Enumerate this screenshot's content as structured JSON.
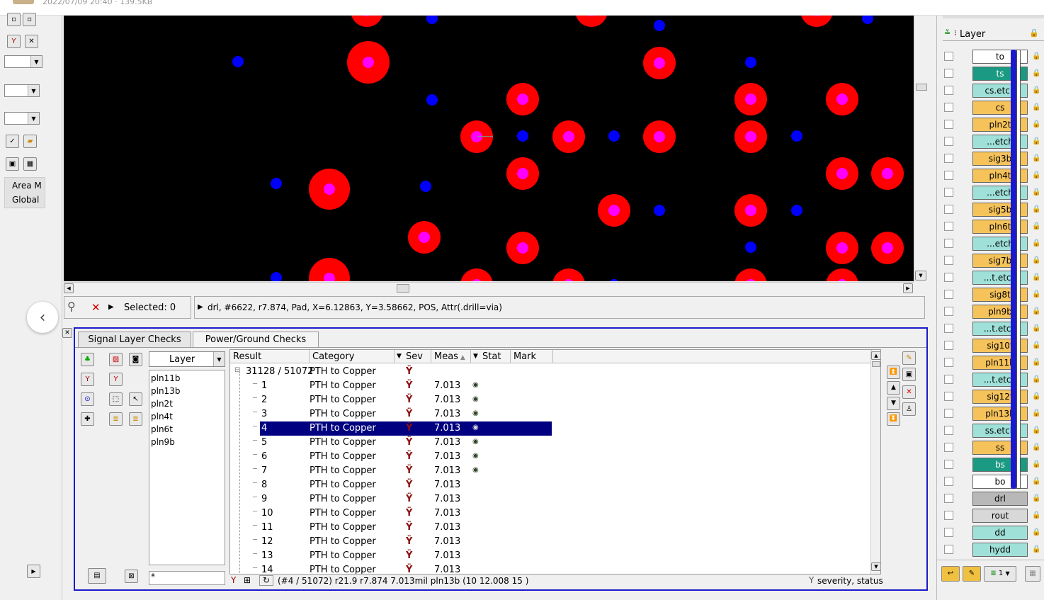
{
  "topbar": {
    "date_text": "2022/07/09 20:40 · 139.5KB"
  },
  "left_panel": {
    "area_label": "Area M",
    "global_label": "Global"
  },
  "status": {
    "selected_text": "Selected: 0",
    "info_text": "drl, #6622, r7.874, Pad, X=6.12863, Y=3.58662, POS, Attr(.drill=via)"
  },
  "checks": {
    "tabs": [
      {
        "label": "Signal Layer Checks",
        "active": false
      },
      {
        "label": "Power/Ground Checks",
        "active": true
      }
    ],
    "layer_combo": "Layer",
    "layers": [
      "pln11b",
      "pln13b",
      "pln2t",
      "pln4t",
      "pln6t",
      "pln9b"
    ],
    "filter_text": "*",
    "columns": [
      "Result",
      "Category",
      "Sev",
      "Meas",
      "Stat",
      "Mark"
    ],
    "group": {
      "result": "31128 / 51072",
      "category": "PTH to Copper"
    },
    "rows": [
      {
        "result": "1",
        "category": "PTH to Copper",
        "meas": "7.013",
        "stat": true
      },
      {
        "result": "2",
        "category": "PTH to Copper",
        "meas": "7.013",
        "stat": true
      },
      {
        "result": "3",
        "category": "PTH to Copper",
        "meas": "7.013",
        "stat": true
      },
      {
        "result": "4",
        "category": "PTH to Copper",
        "meas": "7.013",
        "stat": true,
        "selected": true
      },
      {
        "result": "5",
        "category": "PTH to Copper",
        "meas": "7.013",
        "stat": true
      },
      {
        "result": "6",
        "category": "PTH to Copper",
        "meas": "7.013",
        "stat": true
      },
      {
        "result": "7",
        "category": "PTH to Copper",
        "meas": "7.013",
        "stat": true
      },
      {
        "result": "8",
        "category": "PTH to Copper",
        "meas": "7.013",
        "stat": false
      },
      {
        "result": "9",
        "category": "PTH to Copper",
        "meas": "7.013",
        "stat": false
      },
      {
        "result": "10",
        "category": "PTH to Copper",
        "meas": "7.013",
        "stat": false
      },
      {
        "result": "11",
        "category": "PTH to Copper",
        "meas": "7.013",
        "stat": false
      },
      {
        "result": "12",
        "category": "PTH to Copper",
        "meas": "7.013",
        "stat": false
      },
      {
        "result": "13",
        "category": "PTH to Copper",
        "meas": "7.013",
        "stat": false
      },
      {
        "result": "14",
        "category": "PTH to Copper",
        "meas": "7.013",
        "stat": false
      }
    ],
    "footer_text": "(#4 / 51072)  r21.9 r7.874  7.013mil  pln13b  (10 12.008 15 )",
    "footer_sort": "severity, status"
  },
  "layer_panel": {
    "header": "Layer",
    "layers": [
      {
        "name": "to",
        "color": "#ffffff"
      },
      {
        "name": "ts",
        "color": "#1a9a82"
      },
      {
        "name": "cs.etch",
        "color": "#9fe0d8"
      },
      {
        "name": "cs",
        "color": "#f5c35a"
      },
      {
        "name": "pln2t",
        "color": "#f5c35a"
      },
      {
        "name": "...etch",
        "color": "#9fe0d8"
      },
      {
        "name": "sig3b",
        "color": "#f5c35a"
      },
      {
        "name": "pln4t",
        "color": "#f5c35a"
      },
      {
        "name": "...etch",
        "color": "#9fe0d8"
      },
      {
        "name": "sig5b",
        "color": "#f5c35a"
      },
      {
        "name": "pln6t",
        "color": "#f5c35a"
      },
      {
        "name": "...etch",
        "color": "#9fe0d8"
      },
      {
        "name": "sig7b",
        "color": "#f5c35a"
      },
      {
        "name": "...t.etch",
        "color": "#9fe0d8"
      },
      {
        "name": "sig8t",
        "color": "#f5c35a"
      },
      {
        "name": "pln9b",
        "color": "#f5c35a"
      },
      {
        "name": "...t.etch",
        "color": "#9fe0d8"
      },
      {
        "name": "sig10t",
        "color": "#f5c35a"
      },
      {
        "name": "pln11b",
        "color": "#f5c35a"
      },
      {
        "name": "...t.etch",
        "color": "#9fe0d8"
      },
      {
        "name": "sig12t",
        "color": "#f5c35a"
      },
      {
        "name": "pln13b",
        "color": "#f5c35a"
      },
      {
        "name": "ss.etch",
        "color": "#9fe0d8"
      },
      {
        "name": "ss",
        "color": "#f5c35a"
      },
      {
        "name": "bs",
        "color": "#1a9a82"
      },
      {
        "name": "bo",
        "color": "#ffffff"
      },
      {
        "name": "drl",
        "color": "#b8b8b8"
      },
      {
        "name": "rout",
        "color": "#d8d8d8"
      },
      {
        "name": "dd",
        "color": "#9fe0d8"
      },
      {
        "name": "hydd",
        "color": "#9fe0d8"
      }
    ],
    "footer_count": "1"
  },
  "colors": {
    "accent": "#1a1acc",
    "selection": "#000080",
    "pad": "#ff0000",
    "via": "#0000ff",
    "hole": "#ff00ff"
  }
}
